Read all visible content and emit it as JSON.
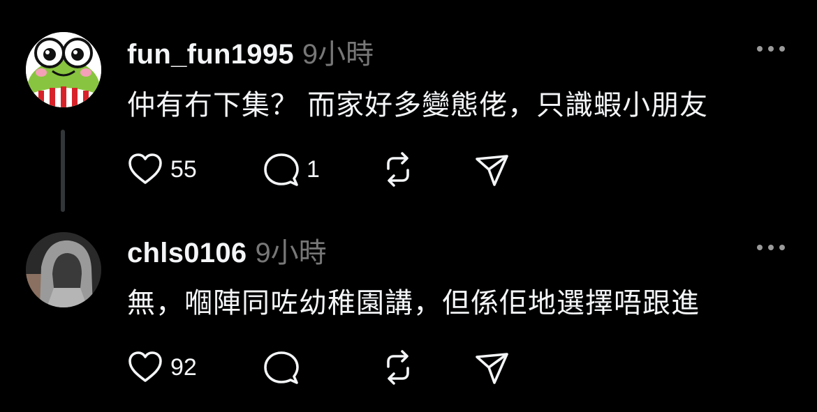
{
  "posts": [
    {
      "username": "fun_fun1995",
      "timestamp": "9小時",
      "text": "仲有冇下集？ 而家好多變態佬，只識蝦小朋友",
      "like_count": "55",
      "reply_count": "1",
      "avatar_icon": "frog-cartoon-avatar",
      "has_thread_line": true
    },
    {
      "username": "chls0106",
      "timestamp": "9小時",
      "text": "無，嗰陣同咗幼稚園講，但係佢地選擇唔跟進",
      "like_count": "92",
      "reply_count": "",
      "avatar_icon": "hooded-person-avatar",
      "has_thread_line": false
    }
  ],
  "icons": {
    "like": "heart-icon",
    "reply": "comment-bubble-icon",
    "repost": "repost-icon",
    "share": "send-icon",
    "more": "more-options-icon"
  },
  "colors": {
    "background": "#000000",
    "primary_text": "#f3f5f7",
    "secondary_text": "#777777",
    "thread_line": "#333638"
  }
}
